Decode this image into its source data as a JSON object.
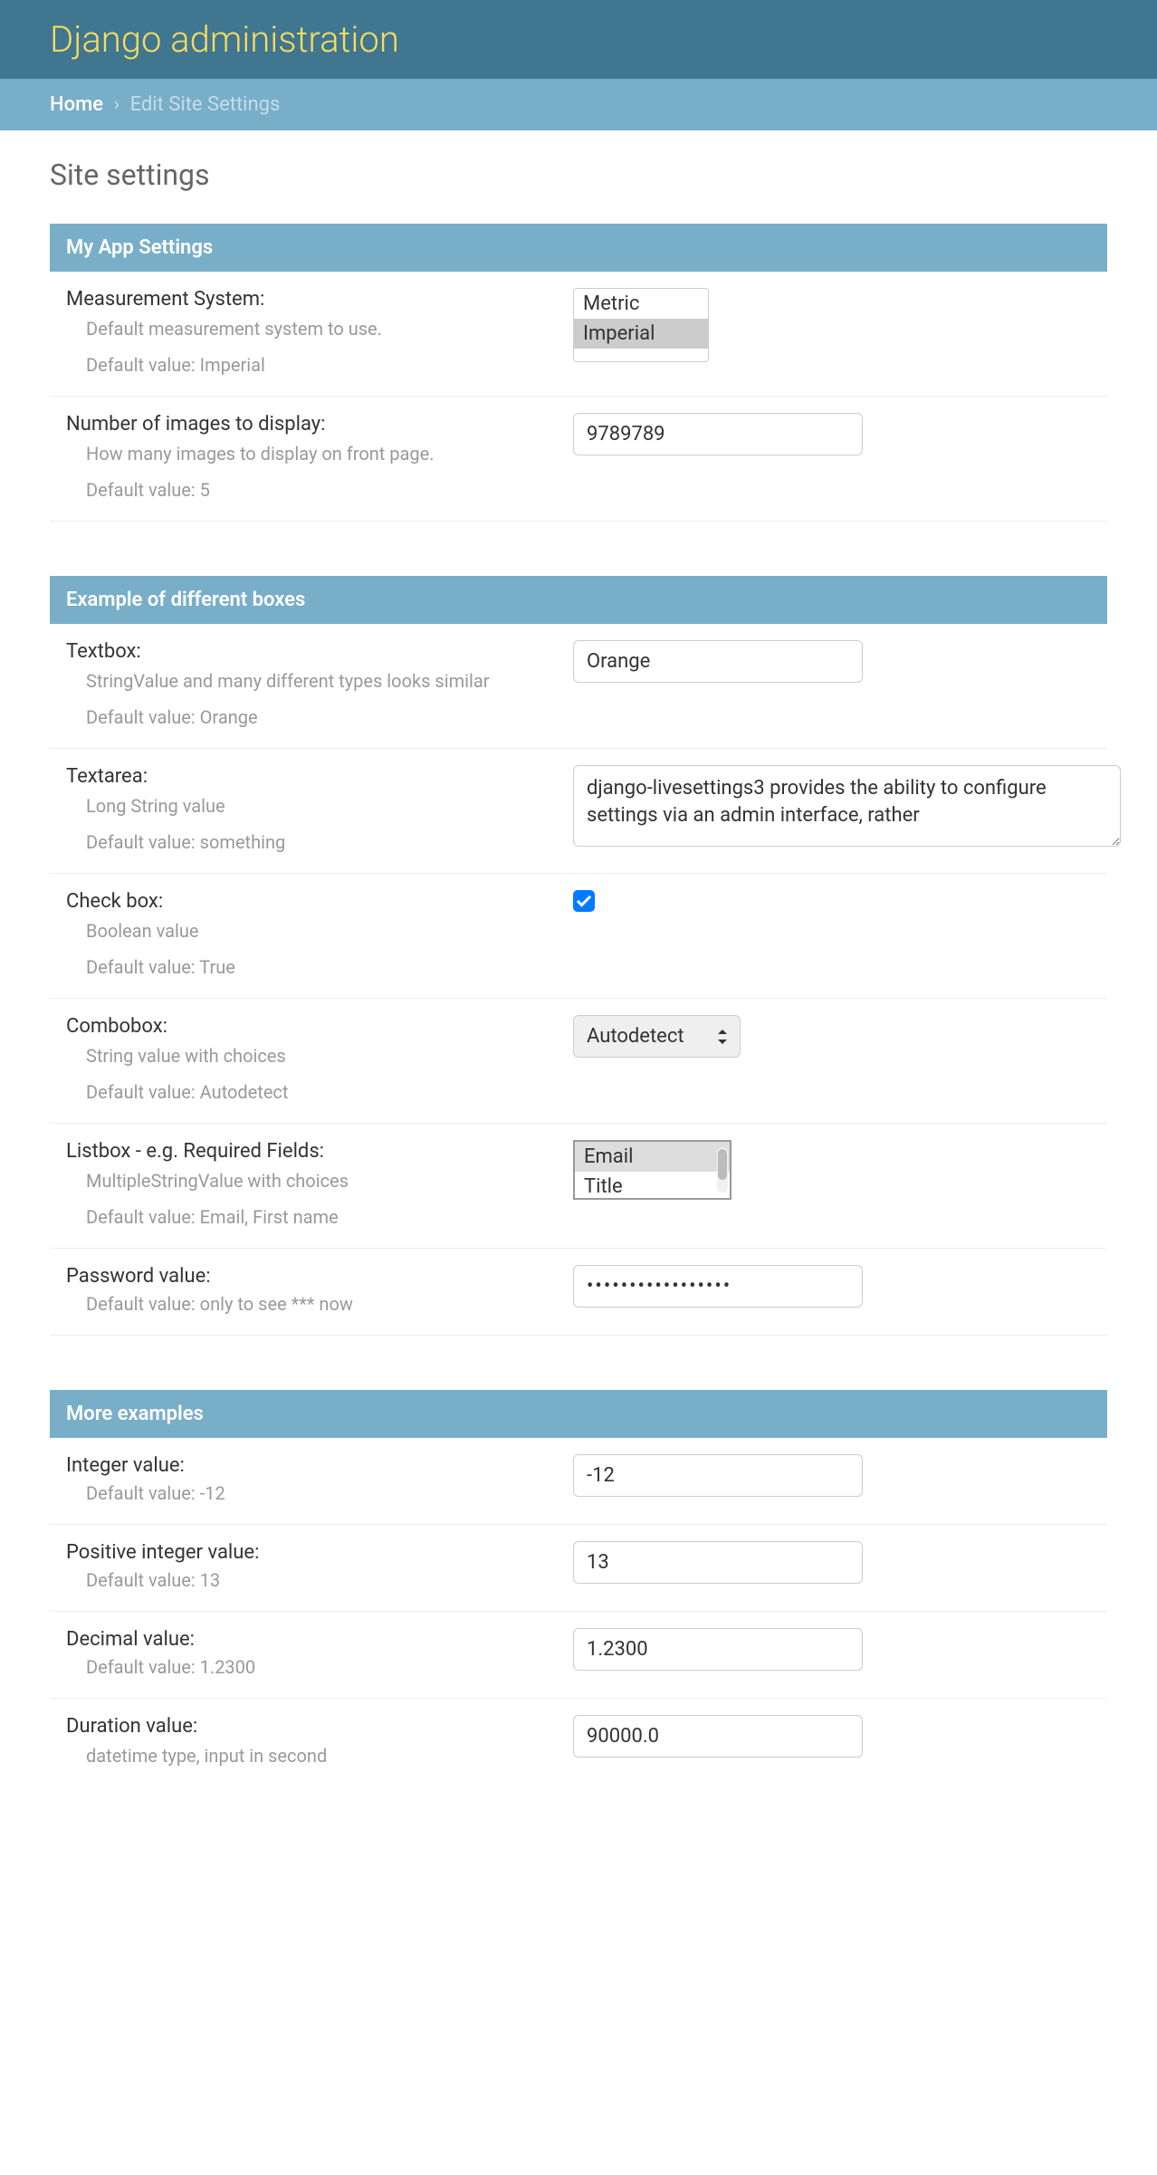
{
  "header": {
    "title": "Django administration"
  },
  "breadcrumbs": {
    "home": "Home",
    "current": "Edit Site Settings"
  },
  "page_title": "Site settings",
  "sections": {
    "my_app": {
      "title": "My App Settings",
      "fields": {
        "measurement": {
          "label": "Measurement System:",
          "help": "Default measurement system to use.",
          "default": "Default value: Imperial",
          "options": [
            "Metric",
            "Imperial"
          ],
          "selected": "Imperial"
        },
        "num_images": {
          "label": "Number of images to display:",
          "help": "How many images to display on front page.",
          "default": "Default value: 5",
          "value": "9789789"
        }
      }
    },
    "examples": {
      "title": "Example of different boxes",
      "fields": {
        "textbox": {
          "label": "Textbox:",
          "help": "StringValue and many different types looks similar",
          "default": "Default value: Orange",
          "value": "Orange"
        },
        "textarea": {
          "label": "Textarea:",
          "help": "Long String value",
          "default": "Default value: something",
          "value": "django-livesettings3 provides the ability to configure settings via an admin interface, rather"
        },
        "checkbox": {
          "label": "Check box:",
          "help": "Boolean value",
          "default": "Default value: True"
        },
        "combobox": {
          "label": "Combobox:",
          "help": "String value with choices",
          "default": "Default value: Autodetect",
          "value": "Autodetect"
        },
        "listbox": {
          "label": "Listbox - e.g. Required Fields:",
          "help": "MultipleStringValue with choices",
          "default": "Default value: Email, First name",
          "options": [
            "Email",
            "Title"
          ],
          "selected": "Email"
        },
        "password": {
          "label": "Password value:",
          "default": "Default value: only to see *** now",
          "value": "•••••••••••••••••"
        }
      }
    },
    "more": {
      "title": "More examples",
      "fields": {
        "integer": {
          "label": "Integer value:",
          "default": "Default value: -12",
          "value": "-12"
        },
        "positive_integer": {
          "label": "Positive integer value:",
          "default": "Default value: 13",
          "value": "13"
        },
        "decimal": {
          "label": "Decimal value:",
          "default": "Default value: 1.2300",
          "value": "1.2300"
        },
        "duration": {
          "label": "Duration value:",
          "help": "datetime type, input in second",
          "value": "90000.0"
        }
      }
    }
  }
}
